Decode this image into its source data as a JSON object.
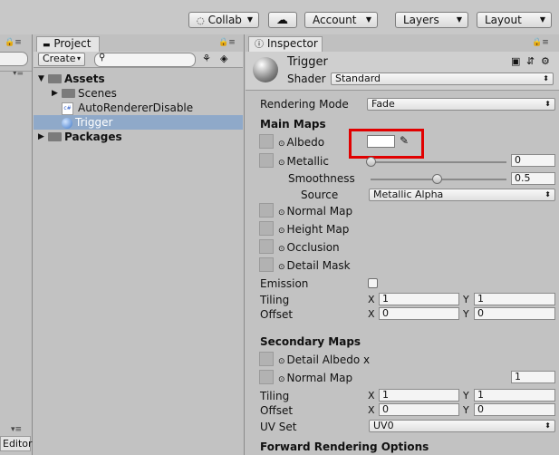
{
  "toolbar": {
    "collab": "Collab",
    "account": "Account",
    "layers": "Layers",
    "layout": "Layout"
  },
  "project": {
    "tab": "Project",
    "create": "Create",
    "tree": [
      "Assets",
      "Scenes",
      "AutoRendererDisable",
      "Trigger",
      "Packages"
    ],
    "selected": "Trigger"
  },
  "left": {
    "editor_tab": "Editor"
  },
  "inspector": {
    "tab": "Inspector",
    "object_name": "Trigger",
    "shader_label": "Shader",
    "shader_value": "Standard",
    "rendering_mode_label": "Rendering Mode",
    "rendering_mode_value": "Fade",
    "main_maps": "Main Maps",
    "albedo": "Albedo",
    "metallic": "Metallic",
    "metallic_value": "0",
    "smoothness": "Smoothness",
    "smoothness_value": "0.5",
    "source_label": "Source",
    "source_value": "Metallic Alpha",
    "normal_map": "Normal Map",
    "height_map": "Height Map",
    "occlusion": "Occlusion",
    "detail_mask": "Detail Mask",
    "emission": "Emission",
    "tiling": "Tiling",
    "offset": "Offset",
    "x": "X",
    "y": "Y",
    "tiling_x": "1",
    "tiling_y": "1",
    "offset_x": "0",
    "offset_y": "0",
    "secondary_maps": "Secondary Maps",
    "detail_albedo": "Detail Albedo x",
    "normal_map2": "Normal Map",
    "normal_map2_value": "1",
    "tiling2_x": "1",
    "tiling2_y": "1",
    "offset2_x": "0",
    "offset2_y": "0",
    "uv_set_label": "UV Set",
    "uv_set_value": "UV0",
    "forward_options": "Forward Rendering Options"
  },
  "colors": {
    "highlight": "#e10000",
    "selection": "#8fa9c9"
  },
  "values": {
    "metallic_level": 0,
    "smoothness_level": 0.5
  }
}
